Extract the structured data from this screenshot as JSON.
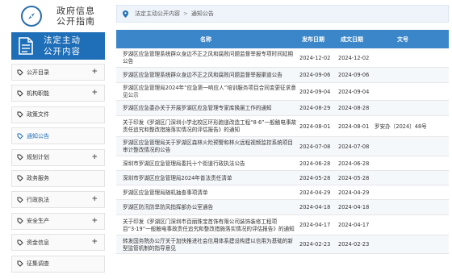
{
  "brand": {
    "line1": "政府信息",
    "line2": "公开指南"
  },
  "active_section": {
    "line1": "法定主动",
    "line2": "公开内容"
  },
  "nav": [
    {
      "label": "公开目录",
      "expand": "+"
    },
    {
      "label": "机构职能",
      "expand": "+"
    },
    {
      "label": "政策文件",
      "expand": ""
    },
    {
      "label": "通知公告",
      "expand": ""
    },
    {
      "label": "规划计划",
      "expand": "+"
    },
    {
      "label": "政务服务",
      "expand": ""
    },
    {
      "label": "行政执法",
      "expand": "+"
    },
    {
      "label": "安全生产",
      "expand": "+"
    },
    {
      "label": "资金信息",
      "expand": "+"
    },
    {
      "label": "征集调查",
      "expand": ""
    }
  ],
  "breadcrumb": {
    "parent": "法定主动公开内容",
    "separator": ">",
    "current": "通知公告"
  },
  "table": {
    "headers": {
      "name": "名称",
      "publish": "发布日期",
      "created": "成文日期",
      "number": "文号"
    },
    "rows": [
      {
        "name": "罗湖区应急管理系统群众身边不正之风和腐败问题监督举报专项时间延期公告",
        "publish": "2024-12-02",
        "created": "2024-12-02",
        "number": ""
      },
      {
        "name": "罗湖区应急管理系统群众身边不正之风和腐败问题监督举报渠道公告",
        "publish": "2024-09-06",
        "created": "2024-09-06",
        "number": ""
      },
      {
        "name": "罗湖区应急管理局2024年“应急第一响应人”培训服务项目合同变更征求意见公示",
        "publish": "2024-09-04",
        "created": "2024-09-04",
        "number": ""
      },
      {
        "name": "罗湖区应急委办关于开展罗湖区应急管理专家库换届工作的通知",
        "publish": "2024-08-29",
        "created": "2024-08-28",
        "number": ""
      },
      {
        "name": "关于印发《罗湖区门深圳小学北校区环形跑道改造工程“8·6”一般触电事故责任追究和整改措施落实情况的评估报告》的通知",
        "publish": "2024-08-01",
        "created": "2024-08-01",
        "number": "罗安办〔2024〕48号"
      },
      {
        "name": "罗湖区应急管理局关于罗湖区森林火险预警和林火远程视频监控系统项目审计整改情况的公告",
        "publish": "2024-07-08",
        "created": "2024-07-08",
        "number": ""
      },
      {
        "name": "深圳市罗湖区应急管理局委托十个街道行政执法公告",
        "publish": "2024-06-28",
        "created": "2024-06-28",
        "number": ""
      },
      {
        "name": "深圳市罗湖区应急管理局2024年普法责任清单",
        "publish": "2024-05-28",
        "created": "2024-05-28",
        "number": ""
      },
      {
        "name": "罗湖区应急管理局随机抽查事项清单",
        "publish": "2024-04-29",
        "created": "2024-04-29",
        "number": ""
      },
      {
        "name": "罗湖区防汛防旱防风指挥部办公室通告",
        "publish": "2024-04-18",
        "created": "2024-04-18",
        "number": ""
      },
      {
        "name": "关于印发《罗湖区门深圳市百丽珠宝首饰有限公司装饰装修工程项目“3·19”一般触电事故责任追究和整改措施落实情况的评估报告》的通知",
        "publish": "2024-04-17",
        "created": "2024-04-17",
        "number": ""
      },
      {
        "name": "转发国务院办公厅关于加快推进社会信用体系建设构建以信用为基础的新型监管机制的指导意见",
        "publish": "2024-02-23",
        "created": "2024-02-23",
        "number": ""
      }
    ]
  },
  "colors": {
    "primary": "#1f6eb8",
    "table_header": "#3b86c9",
    "breadcrumb_bg": "#eef4fa"
  }
}
